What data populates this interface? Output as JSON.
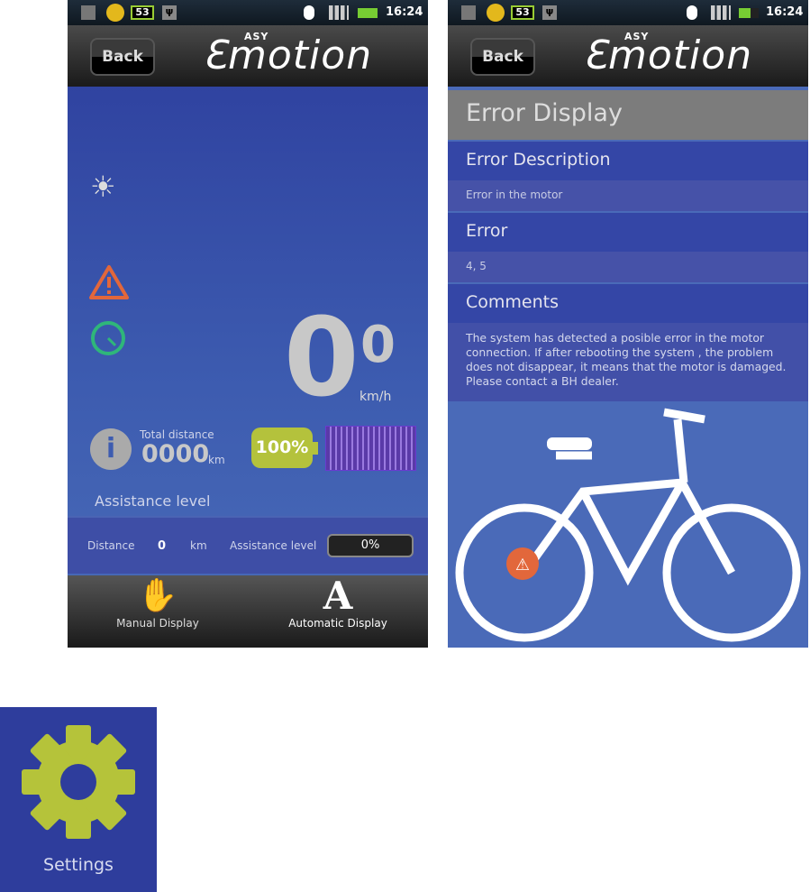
{
  "status_bar": {
    "battery_badge": "53",
    "time": "16:24"
  },
  "header": {
    "back_label": "Back",
    "logo": "EASY motion"
  },
  "dashboard": {
    "speed": "0",
    "speed_sup": "0",
    "speed_unit": "km/h",
    "total_distance_label": "Total distance",
    "total_distance_value": "0000",
    "total_distance_unit": "km",
    "battery_percent": "100%",
    "battery_level": 1.0,
    "assistance_title": "Assistance level",
    "panel": {
      "distance_label": "Distance",
      "distance_value": "0",
      "distance_unit": "km",
      "assistance_label": "Assistance level",
      "assistance_value": "0%"
    },
    "footer": {
      "manual": "Manual Display",
      "automatic": "Automatic Display",
      "automatic_glyph": "A"
    }
  },
  "error_screen": {
    "title": "Error Display",
    "description_heading": "Error Description",
    "description_value": "Error in the motor",
    "error_heading": "Error",
    "error_value": "4, 5",
    "comments_heading": "Comments",
    "comments_value": "The system has detected a posible error in the motor connection. If after rebooting the system , the problem does not disappear, it means that the motor is damaged. Please contact a BH dealer."
  },
  "settings_tile": {
    "label": "Settings",
    "gear_color": "#b5c33a",
    "bg": "#2e3d9c"
  },
  "colors": {
    "warning": "#e2673b",
    "speedometer": "#2fb67a",
    "battery": "#b4c23c",
    "assist_bar": "#5a3aa8"
  }
}
